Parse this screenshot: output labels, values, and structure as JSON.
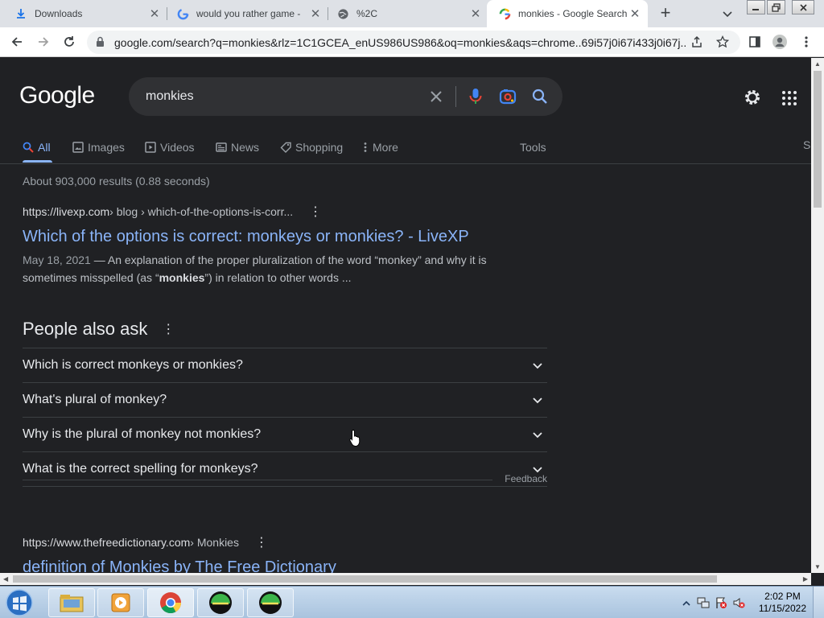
{
  "browser": {
    "tabs": [
      {
        "title": "Downloads",
        "icon": "download-icon",
        "active": false
      },
      {
        "title": "would you rather game -",
        "icon": "google-g-icon",
        "active": false
      },
      {
        "title": "%2C",
        "icon": "globe-icon",
        "active": false
      },
      {
        "title": "monkies - Google Search",
        "icon": "google-g-icon",
        "active": true
      }
    ],
    "url": "google.com/search?q=monkies&rlz=1C1GCEA_enUS986US986&oq=monkies&aqs=chrome..69i57j0i67i433j0i67j..."
  },
  "google": {
    "logo": "Google",
    "query": "monkies",
    "nav": [
      {
        "label": "All",
        "icon": "search-icon",
        "active": true
      },
      {
        "label": "Images",
        "icon": "image-icon"
      },
      {
        "label": "Videos",
        "icon": "video-icon"
      },
      {
        "label": "News",
        "icon": "news-icon"
      },
      {
        "label": "Shopping",
        "icon": "tag-icon"
      },
      {
        "label": "More",
        "icon": "more-vert-icon"
      }
    ],
    "tools_label": "Tools",
    "edge_text": "S",
    "stats": "About 903,000 results (0.88 seconds)",
    "results": [
      {
        "domain": "https://livexp.com",
        "path": " › blog › which-of-the-options-is-corr...",
        "title": "Which of the options is correct: monkeys or monkies? - LiveXP",
        "date": "May 18, 2021",
        "snippet_a": " — An explanation of the proper pluralization of the word “monkey” and why it is sometimes misspelled (as “",
        "snippet_bold": "monkies",
        "snippet_b": "”) in relation to other words ..."
      },
      {
        "domain": "https://www.thefreedictionary.com",
        "path": " › Monkies",
        "title": "definition of Monkies by The Free Dictionary"
      }
    ],
    "paa": {
      "heading": "People also ask",
      "questions": [
        "Which is correct monkeys or monkies?",
        "What's plural of monkey?",
        "Why is the plural of monkey not monkies?",
        "What is the correct spelling for monkeys?"
      ],
      "feedback": "Feedback"
    }
  },
  "taskbar": {
    "time": "2:02 PM",
    "date": "11/15/2022"
  },
  "colors": {
    "page_bg": "#202124",
    "link": "#8ab4f8",
    "text": "#e8eaed"
  }
}
